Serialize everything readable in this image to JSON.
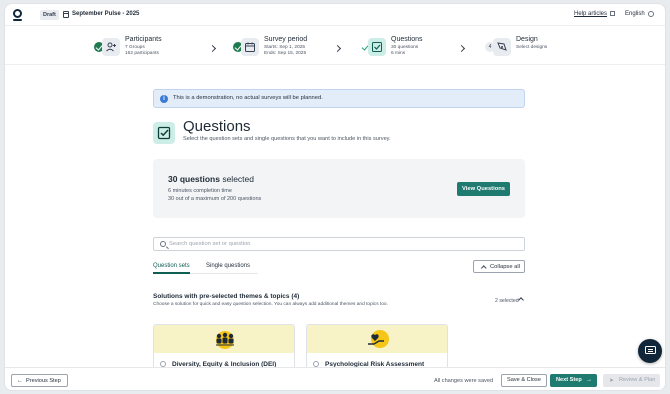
{
  "header": {
    "status_badge": "Draft",
    "survey_name": "September Pulse - 2025",
    "help_label": "Help articles",
    "language": "English"
  },
  "stepper": [
    {
      "title": "Participants",
      "sub1": "7 Groups",
      "sub2": "162 participants",
      "state": "done",
      "icon": "add-user-icon"
    },
    {
      "title": "Survey period",
      "sub1": "Starts: Sep 1, 2025",
      "sub2": "Ends: Sep 15, 2025",
      "state": "done",
      "icon": "calendar-icon"
    },
    {
      "title": "Questions",
      "sub1": "30 questions",
      "sub2": "6 mins",
      "state": "current",
      "icon": "checkbox-icon"
    },
    {
      "title": "Design",
      "sub1": "Select designs",
      "sub2": "",
      "state": "todo",
      "number": "4",
      "icon": "brush-icon"
    }
  ],
  "notice": {
    "text": "This is a demonstration, no actual surveys will be planned."
  },
  "page": {
    "title": "Questions",
    "description": "Select the question sets and single questions that you want to include in this survey."
  },
  "summary": {
    "count_bold": "30 questions",
    "count_rest": " selected",
    "completion": "6 minutes completion time",
    "maximum": "30 out of a maximum of 200 questions",
    "view_button": "View Questions"
  },
  "search": {
    "placeholder": "Search question set or question"
  },
  "tabs": {
    "question_sets": "Question sets",
    "single_questions": "Single questions",
    "collapse_all": "Collapse all"
  },
  "section": {
    "title": "Solutions with pre-selected themes & topics (4)",
    "description": "Choose a solution for quick and easy question selection. You can always add additional themes and topics too.",
    "selected": "2 selected"
  },
  "cards": [
    {
      "name": "Diversity, Equity & Inclusion (DEI)",
      "icon": "people-diversity-illustration"
    },
    {
      "name": "Psychological Risk Assessment",
      "icon": "heart-hand-illustration"
    }
  ],
  "footer": {
    "previous": "Previous Step",
    "saved_status": "All changes were saved",
    "save_close": "Save & Close",
    "next": "Next Step",
    "review": "Review & Plan"
  },
  "colors": {
    "accent": "#1f7a6f",
    "success": "#1f7a4f",
    "notice_bg": "#e3edf9",
    "card_banner": "#f8f2c7"
  }
}
